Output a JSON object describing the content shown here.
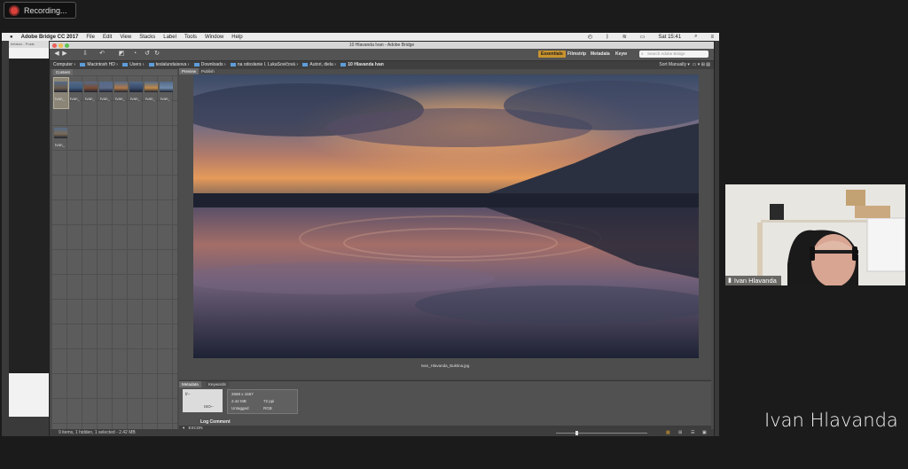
{
  "recording": {
    "label": "Recording..."
  },
  "macos": {
    "app_name": "Adobe Bridge CC 2017",
    "menus": [
      "File",
      "Edit",
      "View",
      "Stacks",
      "Label",
      "Tools",
      "Window",
      "Help"
    ],
    "clock": "Sat 15:41"
  },
  "browser_bg": {
    "tab_text": "Infobox - Posts"
  },
  "bridge": {
    "window_title": "10 Hlavanda Ivan - Adobe Bridge",
    "workspaces": [
      "Essentials",
      "Filmstrip",
      "Metadata",
      "Keyw"
    ],
    "search_placeholder": "Search Adobe Bridge",
    "path": [
      "Computer",
      "Macintosh HD",
      "Users",
      "teslalundaisova",
      "Downloads",
      "na odoslanie I. LukaSovičová",
      "Autori, diela",
      "10 Hlavanda Ivan"
    ],
    "sort_label": "Sort Manually",
    "content_tab": "Content",
    "preview_tabs": [
      "Preview",
      "Publish"
    ],
    "thumb_labels": [
      "Ivan_",
      "Ivan_",
      "Ivan_",
      "Ivan_",
      "Ivan_",
      "Ivan_",
      "Ivan_",
      "Ivan_",
      "Ivan_"
    ],
    "thumb_colors": [
      "#6a5c4f",
      "#3f5a7a",
      "#7a4c35",
      "#5f6b88",
      "#b0794a",
      "#394b6a",
      "#c08a4a",
      "#6f8aa8",
      "#7a6a55"
    ],
    "preview_filename": "Ivan_Hlavanda_Buktina.jpg",
    "meta_tabs": [
      "Metadata",
      "Keywords"
    ],
    "meta": {
      "dimensions": "2668 x 1667",
      "size": "2.42 MB",
      "ppi": "72 ppi",
      "tagged": "Untagged",
      "mode": "RGB",
      "img_label": "f/--",
      "img_iso": "ISO--",
      "log_comment": "Log Comment",
      "section": "EXCON"
    },
    "status": "9 items, 1 hidden, 1 selected - 2.42 MB"
  },
  "speaker": {
    "name": "Ivan Hlavanda"
  },
  "big_name": "Ivan Hlavanda",
  "colors": {
    "accent": "#c8932e",
    "rec": "#d9413a",
    "folder": "#5d9ddb"
  }
}
